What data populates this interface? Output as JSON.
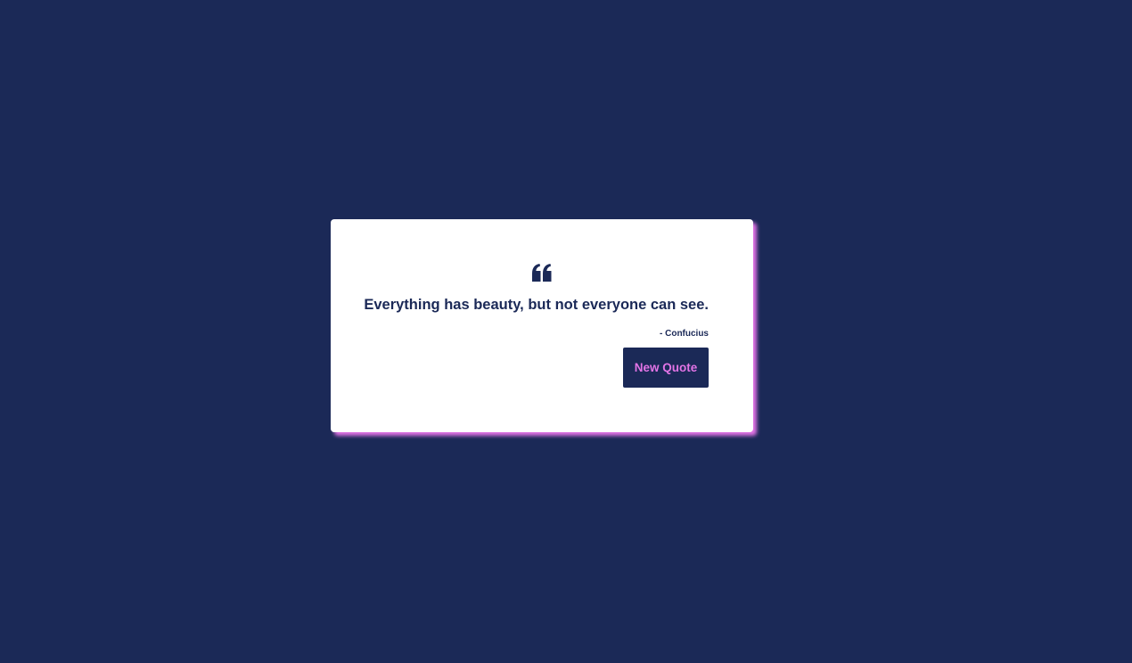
{
  "quote": {
    "icon": "quote-left-icon",
    "text": "Everything has beauty, but not everyone can see.",
    "author": "- Confucius"
  },
  "actions": {
    "new_quote_label": "New Quote"
  },
  "colors": {
    "background": "#1b2957",
    "card": "#ffffff",
    "accent": "#e274e6",
    "text": "#1b2957"
  }
}
